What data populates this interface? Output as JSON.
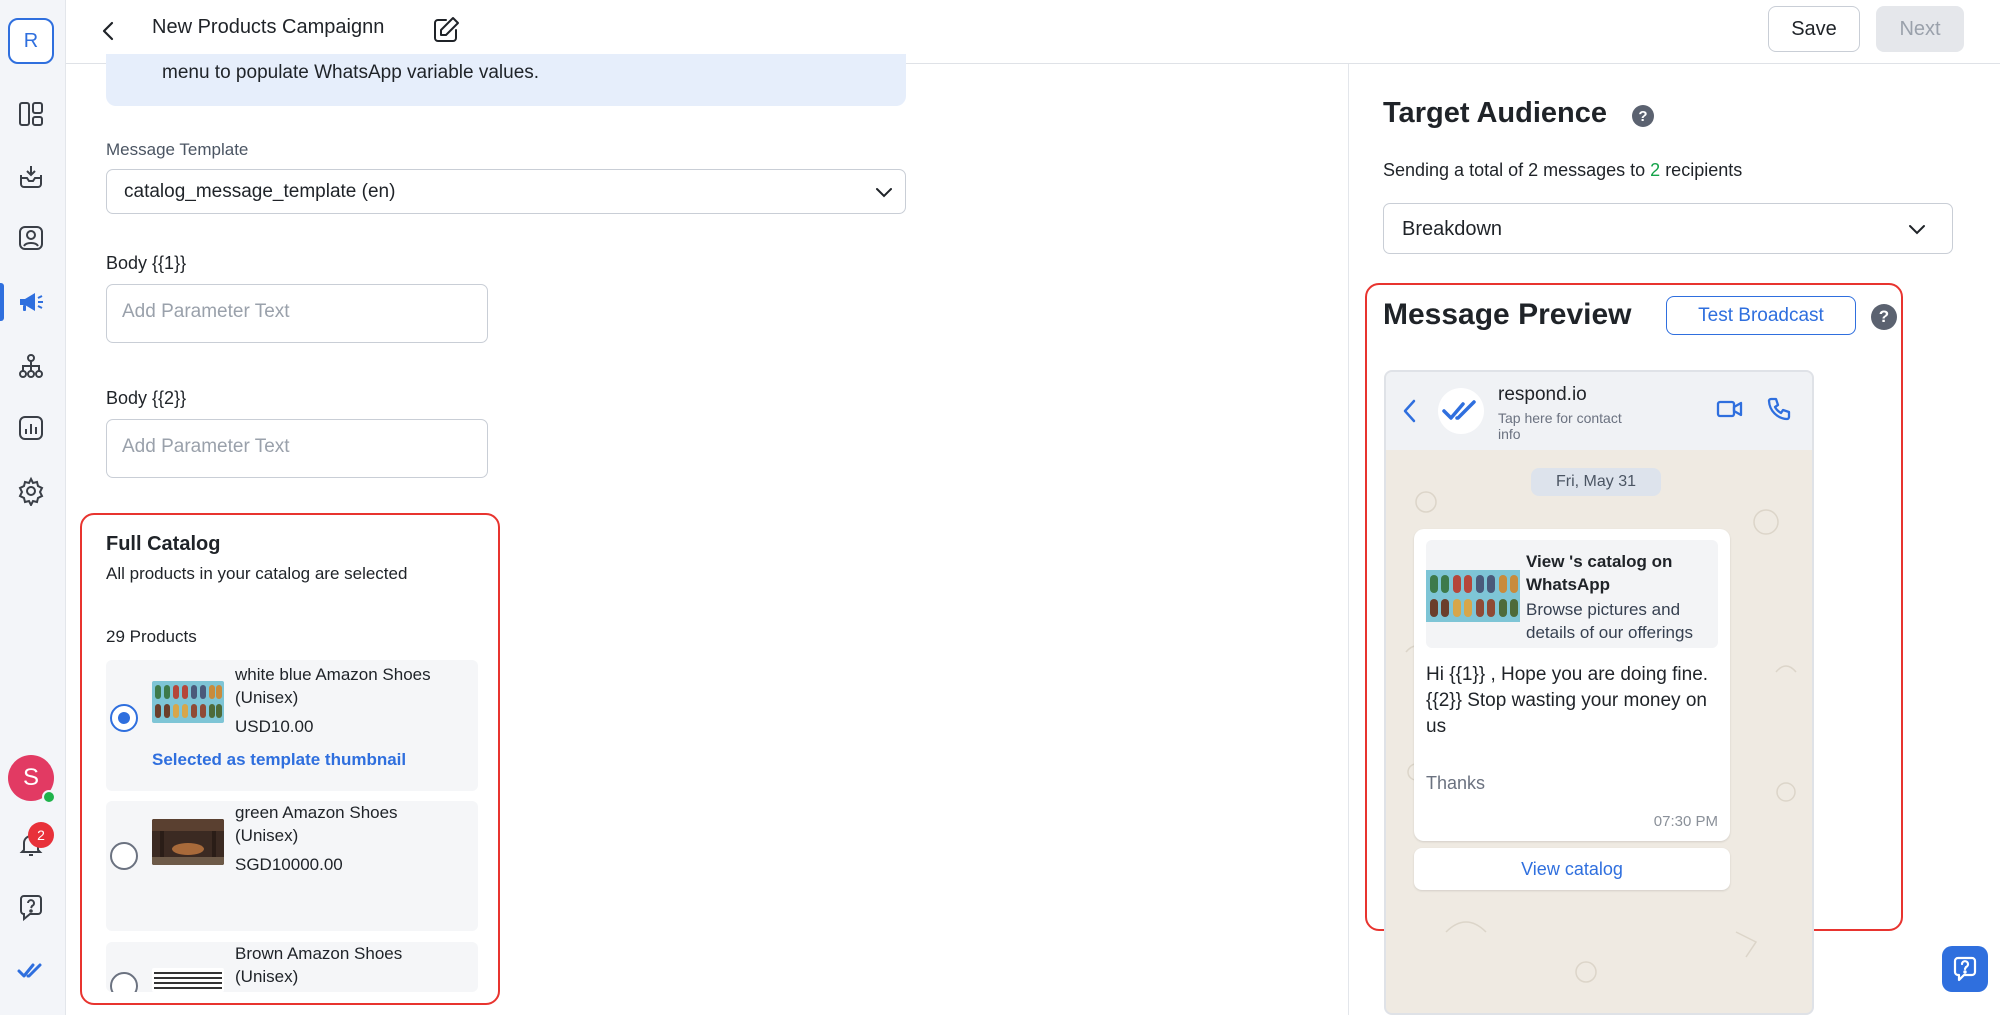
{
  "sidebar": {
    "workspace_initial": "R",
    "user_initial": "S",
    "notification_count": "2"
  },
  "header": {
    "title": "New Products Campaignn",
    "save_label": "Save",
    "next_label": "Next"
  },
  "form": {
    "info_text": "menu to populate WhatsApp variable values.",
    "template_label": "Message Template",
    "template_value": "catalog_message_template (en)",
    "body1_label": "Body {{1}}",
    "body1_placeholder": "Add Parameter Text",
    "body2_label": "Body {{2}}",
    "body2_placeholder": "Add Parameter Text"
  },
  "catalog": {
    "title": "Full Catalog",
    "subtitle": "All products in your catalog are selected",
    "count": "29 Products",
    "products": [
      {
        "name": "white blue Amazon Shoes (Unisex)",
        "price": "USD10.00",
        "selected": true,
        "note": "Selected as template thumbnail"
      },
      {
        "name": "green Amazon Shoes (Unisex)",
        "price": "SGD10000.00",
        "selected": false
      },
      {
        "name": "Brown Amazon Shoes (Unisex)",
        "selected": false
      }
    ]
  },
  "audience": {
    "title": "Target Audience",
    "summary_prefix": "Sending a total of 2 messages to ",
    "summary_count": "2",
    "summary_suffix": " recipients",
    "breakdown_label": "Breakdown"
  },
  "preview": {
    "title": "Message Preview",
    "test_button": "Test Broadcast",
    "contact_name": "respond.io",
    "contact_sub": "Tap here for contact info",
    "date": "Fri, May 31",
    "catalog_title": "View 's catalog on WhatsApp",
    "catalog_desc": "Browse pictures and details of our offerings",
    "body": "Hi {{1}} , Hope you are doing fine.\n{{2}} Stop wasting your money on us",
    "footer": "Thanks",
    "time": "07:30 PM",
    "view_catalog": "View catalog"
  },
  "colors": {
    "accent": "#2f6fde",
    "highlight_outline": "#e8342f",
    "online": "#1fb34b",
    "count_green": "#16a34a"
  },
  "icons": [
    "dashboard-icon",
    "inbox-icon",
    "contacts-icon",
    "broadcast-icon",
    "workflows-icon",
    "reports-icon",
    "settings-icon",
    "bell-icon",
    "help-icon",
    "respond-logo-icon"
  ]
}
